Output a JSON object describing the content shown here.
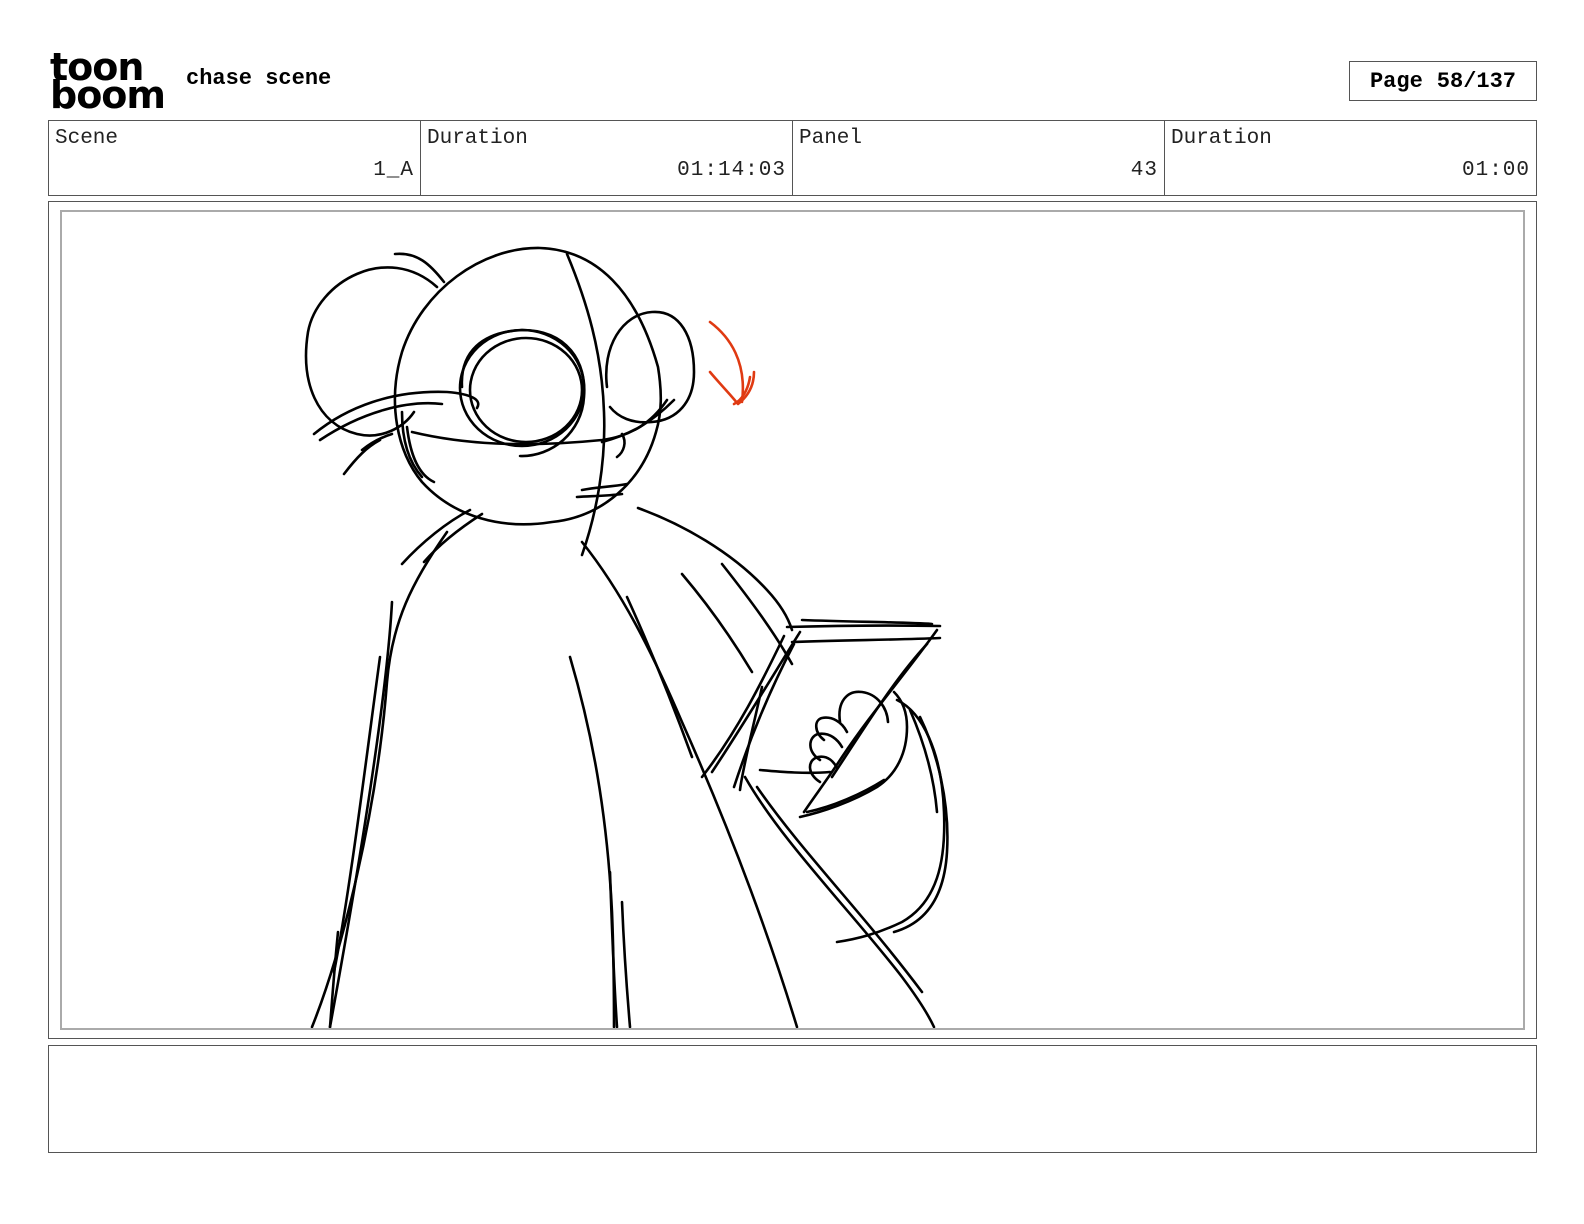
{
  "header": {
    "logo_top": "toon",
    "logo_bottom": "boom",
    "project_title": "chase scene",
    "page_label": "Page",
    "page_value": "58/137"
  },
  "info": {
    "scene_label": "Scene",
    "scene_value": "1_A",
    "scene_duration_label": "Duration",
    "scene_duration_value": "01:14:03",
    "panel_label": "Panel",
    "panel_value": "43",
    "panel_duration_label": "Duration",
    "panel_duration_value": "01:00"
  },
  "sketch": {
    "line_color": "#000000",
    "accent_color": "#e03a12"
  },
  "notes": {
    "text": ""
  }
}
